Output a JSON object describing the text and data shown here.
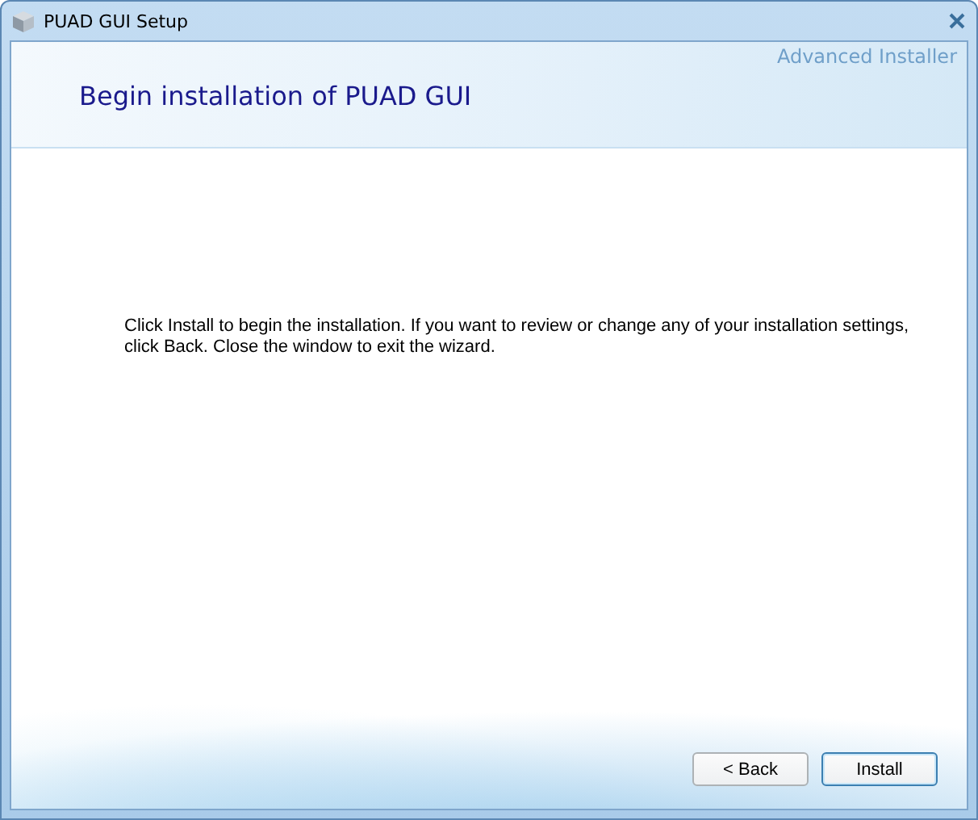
{
  "window": {
    "title": "PUAD GUI Setup"
  },
  "brand": "Advanced Installer",
  "heading": "Begin installation of PUAD GUI",
  "message": "Click Install to begin the installation.  If you want to review or change any of your installation settings, click Back.  Close the window to exit the wizard.",
  "buttons": [
    {
      "label": "< Back",
      "default": false
    },
    {
      "label": "Install",
      "default": true
    }
  ]
}
